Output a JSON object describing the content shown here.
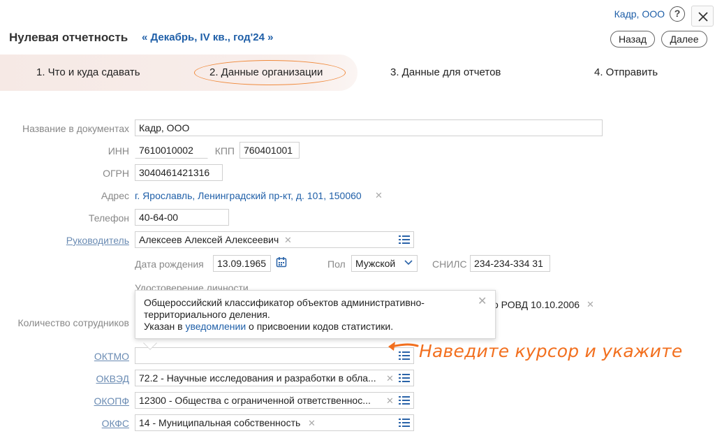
{
  "header": {
    "org_name": "Кадр, ООО",
    "help_icon": "?",
    "title": "Нулевая отчетность",
    "period_prev": "«",
    "period_label": "Декабрь, IV кв., год'24",
    "period_next": "»",
    "back_label": "Назад",
    "next_label": "Далее"
  },
  "steps": [
    {
      "label": "1. Что и куда сдавать"
    },
    {
      "label": "2. Данные организации"
    },
    {
      "label": "3. Данные для отчетов"
    },
    {
      "label": "4. Отправить"
    }
  ],
  "form": {
    "name_label": "Название в документах",
    "name_value": "Кадр, ООО",
    "inn_label": "ИНН",
    "inn_value": "7610010002",
    "kpp_label": "КПП",
    "kpp_value": "760401001",
    "ogrn_label": "ОГРН",
    "ogrn_value": "3040461421316",
    "address_label": "Адрес",
    "address_value": "г. Ярославль, Ленинградский пр-кт, д. 101, 150060",
    "phone_label": "Телефон",
    "phone_value": "40-64-00",
    "director_label": "Руководитель",
    "director_value": "Алексеев Алексей Алексеевич",
    "birth_label": "Дата рождения",
    "birth_value": "13.09.1965",
    "sex_label": "Пол",
    "sex_value": "Мужской",
    "snils_label": "СНИЛС",
    "snils_value": "234-234-334 31",
    "id_doc_label": "Удостоверение личности",
    "id_doc_value_tail": "о РОВД 10.10.2006",
    "employees_label": "Количество сотрудников",
    "oktmo_label": "ОКТМО",
    "oktmo_value": "",
    "okved_label": "ОКВЭД",
    "okved_value": "72.2 - Научные исследования и разработки в обла...",
    "okopf_label": "ОКОПФ",
    "okopf_value": "12300 - Общества с ограниченной ответственнос...",
    "okfs_label": "ОКФС",
    "okfs_value": "14 - Муниципальная собственность"
  },
  "tooltip": {
    "line1": "Общероссийский классификатор объектов административно-",
    "line2": "территориального деления.",
    "line3_prefix": "Указан в ",
    "line3_link": "уведомлении",
    "line3_suffix": " о присвоении кодов статистики."
  },
  "annotation": {
    "text": "Наведите курсор и укажите"
  },
  "colors": {
    "link": "#1f5fa8",
    "accent": "#f26f1e",
    "steps_bg": "#f6e9e5"
  }
}
